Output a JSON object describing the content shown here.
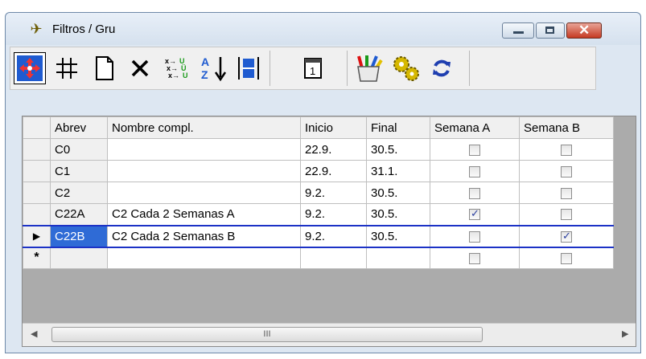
{
  "window": {
    "title": "Filtros / Gru",
    "controls": {
      "minimize": "minimize",
      "maximize": "maximize",
      "close": "close"
    }
  },
  "toolbar": {
    "buttons": [
      {
        "name": "move-icon",
        "glyph": "✥"
      },
      {
        "name": "grid-icon",
        "glyph": "♯"
      },
      {
        "name": "new-document-icon",
        "glyph": "🗋"
      },
      {
        "name": "delete-icon",
        "glyph": "✕"
      },
      {
        "name": "replace-icon",
        "glyph": "⇆"
      },
      {
        "name": "sort-az-icon",
        "glyph": "A↓"
      },
      {
        "name": "column-width-icon",
        "glyph": "⇔"
      },
      {
        "name": "calendar-icon",
        "glyph": "1"
      },
      {
        "name": "color-pencils-icon",
        "glyph": "✎"
      },
      {
        "name": "settings-gears-icon",
        "glyph": "⚙"
      },
      {
        "name": "refresh-icon",
        "glyph": "↻"
      }
    ]
  },
  "table": {
    "columns": [
      "Abrev",
      "Nombre compl.",
      "Inicio",
      "Final",
      "Semana A",
      "Semana B"
    ],
    "rows": [
      {
        "abrev": "C0",
        "nombre": "",
        "inicio": "22.9.",
        "final": "30.5.",
        "semana_a": false,
        "semana_b": false
      },
      {
        "abrev": "C1",
        "nombre": "",
        "inicio": "22.9.",
        "final": "31.1.",
        "semana_a": false,
        "semana_b": false
      },
      {
        "abrev": "C2",
        "nombre": "",
        "inicio": "9.2.",
        "final": "30.5.",
        "semana_a": false,
        "semana_b": false
      },
      {
        "abrev": "C22A",
        "nombre": "C2 Cada 2 Semanas A",
        "inicio": "9.2.",
        "final": "30.5.",
        "semana_a": true,
        "semana_b": false
      },
      {
        "abrev": "C22B",
        "nombre": "C2 Cada 2 Semanas B",
        "inicio": "9.2.",
        "final": "30.5.",
        "semana_a": false,
        "semana_b": true
      }
    ],
    "current_row_marker": "▶",
    "new_row_marker": "*"
  },
  "scrollbar": {
    "thumb_grip": "III",
    "left_arrow": "◀",
    "right_arrow": "▶"
  }
}
